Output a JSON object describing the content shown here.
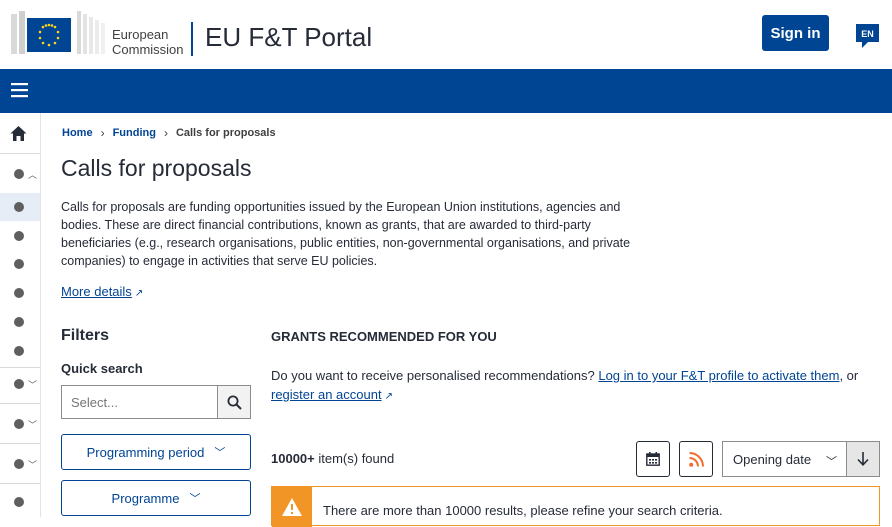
{
  "header": {
    "org_line1": "European",
    "org_line2": "Commission",
    "portal_title": "EU F&T Portal",
    "signin_label": "Sign in",
    "lang_code": "EN",
    "brand_color": "#004494"
  },
  "breadcrumb": {
    "items": [
      "Home",
      "Funding",
      "Calls for proposals"
    ]
  },
  "main": {
    "title": "Calls for proposals",
    "intro": "Calls for proposals are funding opportunities issued by the European Union institutions, agencies and bodies. These are direct financial contributions, known as grants, that are awarded to third-party beneficiaries (e.g., research organisations, public entities, non-governmental organisations, and private companies) to engage in activities that serve EU policies.",
    "more_details": "More details"
  },
  "filters": {
    "heading": "Filters",
    "quick_search_label": "Quick search",
    "quick_search_placeholder": "Select...",
    "buttons": [
      "Programming period",
      "Programme"
    ]
  },
  "grants": {
    "heading": "GRANTS RECOMMENDED FOR YOU",
    "text_before": "Do you want to receive personalised recommendations? ",
    "login_link": "Log in to your F&T profile to activate them",
    "text_middle": ", or",
    "register_link": "register an account"
  },
  "results": {
    "count": "10000+",
    "count_suffix": " item(s) found",
    "sort_value": "Opening date",
    "warning": "There are more than 10000 results, please refine your search criteria.",
    "warning_color": "#f29527"
  }
}
